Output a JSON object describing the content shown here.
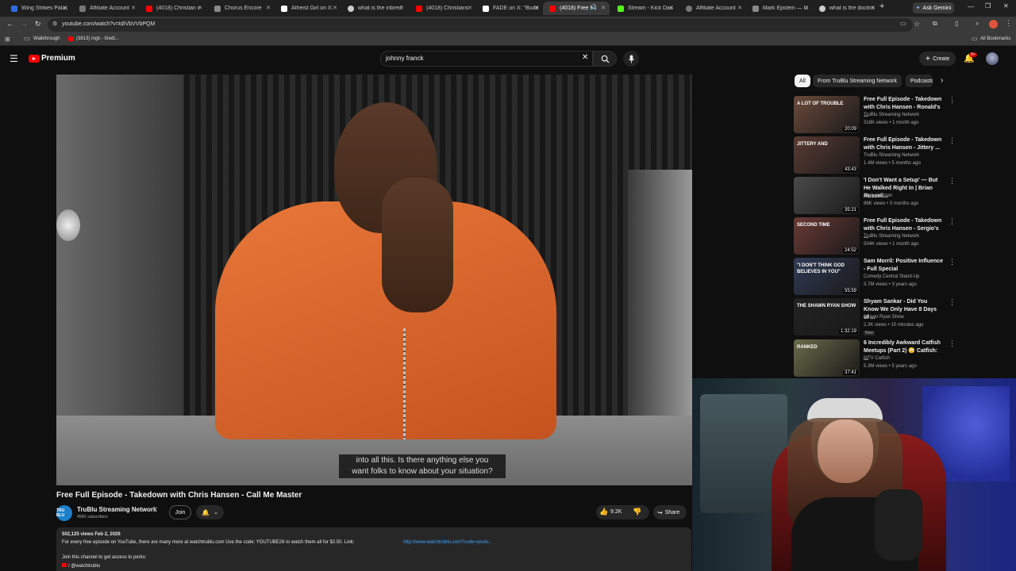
{
  "browser": {
    "tabs": [
      {
        "title": "Wing Strikes Palac",
        "color": "#2d6cdf"
      },
      {
        "title": "Affiliate Account",
        "color": "#777777"
      },
      {
        "title": "(4018) Christian v",
        "color": "#ff0000"
      },
      {
        "title": "Chorus Encore",
        "color": "#888888"
      },
      {
        "title": "Atheist Girl on X:",
        "color": "#ffffff"
      },
      {
        "title": "what is the inbred",
        "color": "#cccccc"
      },
      {
        "title": "(4018) Christians ",
        "color": "#ff0000"
      },
      {
        "title": "FADE on X: \"Budd",
        "color": "#ffffff"
      },
      {
        "title": "(4018) Free Fu",
        "color": "#ff0000"
      },
      {
        "title": "Stream - Kick Das",
        "color": "#53fc18"
      },
      {
        "title": "Affiliate Account",
        "color": "#777777"
      },
      {
        "title": "Mark Epstein — U",
        "color": "#888888"
      },
      {
        "title": "what is the doctrin",
        "color": "#cccccc"
      }
    ],
    "new_tab": "+",
    "ask_gemini": "Ask Gemini",
    "url": "youtube.com/watch?v=tdIVbVVbPQM",
    "bookmarks": [
      {
        "label": "Walkthrough"
      },
      {
        "label": "(3813) mgk - tiredi..."
      }
    ],
    "all_bookmarks": "All Bookmarks"
  },
  "youtube": {
    "logo_text": "Premium",
    "search_value": "johnny franck",
    "create_label": "Create",
    "notif_count": "9+",
    "chips": [
      "All",
      "From TruBlu Streaming Network",
      "Podcasts"
    ],
    "caption_line1": "into all this. Is there anything else you",
    "caption_line2": "want folks to know about your situation?",
    "video_title": "Free Full Episode - Takedown with Chris Hansen - Call Me Master",
    "channel_name": "TruBlu Streaming Network",
    "channel_avatar_text": "TRU BLU",
    "subscribers": "456K subscribers",
    "join_label": "Join",
    "likes": "9.2K",
    "share_label": "Share",
    "views_date": "502,125 views  Feb 2, 2026",
    "desc_line1": "For every free episode on YouTube, there are many more at watchtrublu.com  Use the code: YOUTUBE26 to watch them all for $2.50.  Link:",
    "desc_link": "http://www.watchtrublu.com?code=youtu...",
    "desc_line2": "Join this channel to get access to perks:",
    "desc_handle": "/ @watchtrublu",
    "recommendations": [
      {
        "title": "Free Full Episode - Takedown with Chris Hansen - Ronald's ...",
        "channel": "TruBlu Streaming Network",
        "meta": "319K views • 1 month ago",
        "duration": "20:09",
        "thumb_text": "A LOT OF TROUBLE",
        "thumb_color": "#6b4a3a",
        "new": ""
      },
      {
        "title": "Free Full Episode - Takedown with Chris Hansen - Jittery ...",
        "channel": "TruBlu Streaming Network",
        "meta": "1.4M views • 5 months ago",
        "duration": "43:43",
        "thumb_text": "JITTERY AND",
        "thumb_color": "#5a3b33",
        "new": ""
      },
      {
        "title": "'I Don't Want a Setup' — But He Walked Right In | Brian Russell...",
        "channel": "Chris Hansen",
        "meta": "96K views • 3 months ago",
        "duration": "35:21",
        "thumb_text": "",
        "thumb_color": "#4a4a4a",
        "new": ""
      },
      {
        "title": "Free Full Episode - Takedown with Chris Hansen - Sergio's ...",
        "channel": "TruBlu Streaming Network",
        "meta": "504K views • 1 month ago",
        "duration": "24:52",
        "thumb_text": "SECOND TIME",
        "thumb_color": "#6a3a35",
        "new": ""
      },
      {
        "title": "Sam Morril: Positive Influence - Full Special",
        "channel": "Comedy Central Stand-Up",
        "meta": "3.7M views • 3 years ago",
        "duration": "55:59",
        "thumb_text": "\"I DON'T THINK GOD BELIEVES IN YOU\"",
        "thumb_color": "#2f3a55",
        "new": ""
      },
      {
        "title": "Shyam Sankar - Did You Know We Only Have 8 Days of ...",
        "channel": "Shawn Ryan Show",
        "meta": "2.3K views • 10 minutes ago",
        "duration": "1:32:19",
        "thumb_text": "THE SHAWN RYAN SHOW",
        "thumb_color": "#222222",
        "new": "New"
      },
      {
        "title": "6 Incredibly Awkward Catfish Meetups (Part 2) 😳 Catfish: ...",
        "channel": "MTV Catfish",
        "meta": "5.3M views • 5 years ago",
        "duration": "37:41",
        "thumb_text": "RANKED",
        "thumb_color": "#6a6a4a",
        "new": ""
      }
    ]
  }
}
